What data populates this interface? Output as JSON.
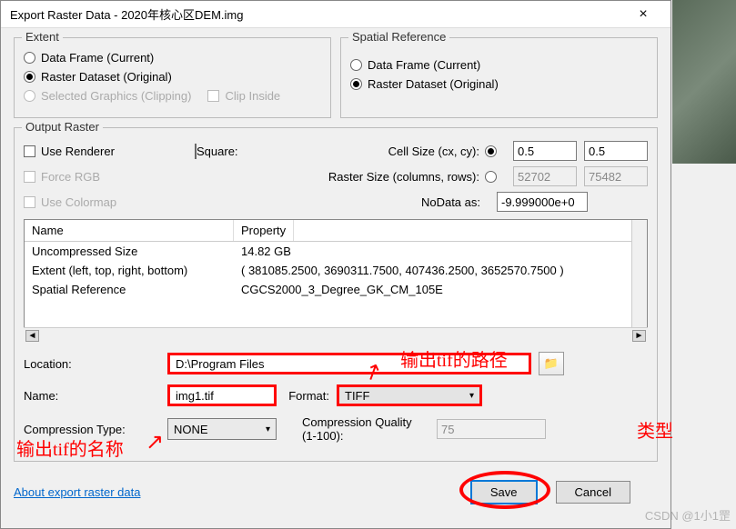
{
  "window": {
    "title": "Export Raster Data - 2020年核心区DEM.img"
  },
  "extent": {
    "legend": "Extent",
    "dataFrame": "Data Frame (Current)",
    "rasterDataset": "Raster Dataset (Original)",
    "selectedGraphics": "Selected Graphics (Clipping)",
    "clipInside": "Clip Inside"
  },
  "spatialRef": {
    "legend": "Spatial Reference",
    "dataFrame": "Data Frame (Current)",
    "rasterDataset": "Raster Dataset (Original)"
  },
  "output": {
    "legend": "Output Raster",
    "useRenderer": "Use Renderer",
    "square": "Square:",
    "forceRGB": "Force RGB",
    "useColormap": "Use Colormap",
    "cellSize": "Cell Size (cx, cy):",
    "rasterSize": "Raster Size (columns, rows):",
    "noData": "NoData as:",
    "cx": "0.5",
    "cy": "0.5",
    "cols": "52702",
    "rows": "75482",
    "noDataVal": "-9.999000e+0"
  },
  "table": {
    "hName": "Name",
    "hProp": "Property",
    "rows": [
      {
        "n": "Uncompressed Size",
        "p": "14.82 GB"
      },
      {
        "n": "Extent (left, top, right, bottom)",
        "p": "( 381085.2500, 3690311.7500, 407436.2500, 3652570.7500 )"
      },
      {
        "n": "Spatial Reference",
        "p": "CGCS2000_3_Degree_GK_CM_105E"
      }
    ]
  },
  "form": {
    "locationLbl": "Location:",
    "location": "D:\\Program Files",
    "nameLbl": "Name:",
    "name": "img1.tif",
    "formatLbl": "Format:",
    "format": "TIFF",
    "compTypeLbl": "Compression Type:",
    "compType": "NONE",
    "compQualLbl": "Compression Quality (1-100):",
    "compQual": "75"
  },
  "link": "About export raster data",
  "buttons": {
    "save": "Save",
    "cancel": "Cancel"
  },
  "annotations": {
    "path": "输出tif的路径",
    "name": "输出tif的名称",
    "type": "类型"
  },
  "watermark": "CSDN @1小1罡"
}
